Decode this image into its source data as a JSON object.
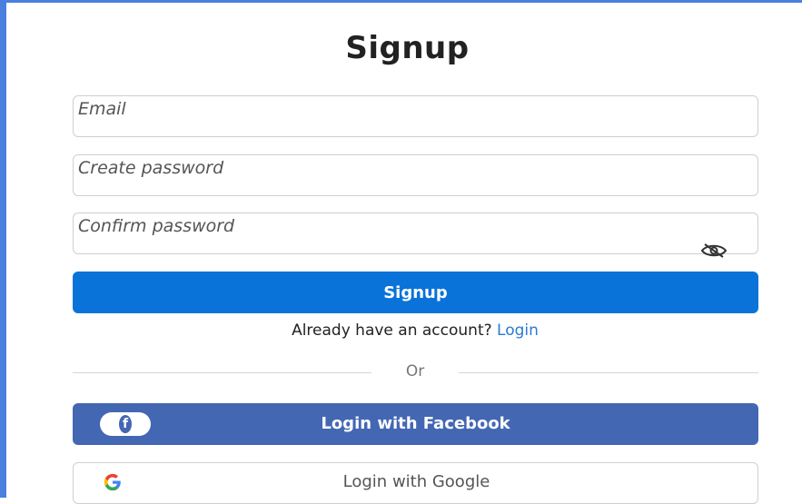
{
  "form": {
    "title": "Signup",
    "email_placeholder": "Email",
    "create_password_placeholder": "Create password",
    "confirm_password_placeholder": "Confirm password",
    "visibility_icon": "eye-off-icon",
    "submit_label": "Signup",
    "have_account_text": "Already have an account?",
    "login_link": "Login"
  },
  "divider": {
    "text": "Or"
  },
  "social": {
    "facebook_label": "Login with Facebook",
    "facebook_icon": "facebook-icon",
    "facebook_color": "#4467b3",
    "google_label": "Login with Google",
    "google_icon": "google-icon"
  },
  "colors": {
    "primary": "#0a73d9",
    "link": "#2a7ad4",
    "frame_border": "#4a7fe0"
  }
}
